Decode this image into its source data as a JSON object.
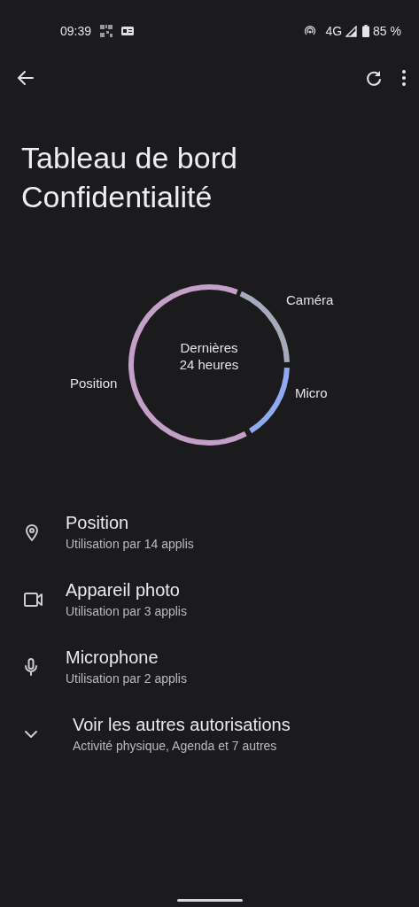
{
  "status_bar": {
    "time": "09:39",
    "network": "4G",
    "battery": "85 %"
  },
  "title": "Tableau de bord Confidentialité",
  "usage_ring": {
    "center_text": [
      "Dernières",
      "24 heures"
    ],
    "segments": [
      {
        "label": "Position",
        "color": "#c49fc8"
      },
      {
        "label": "Caméra",
        "color": "#a6abbb"
      },
      {
        "label": "Micro",
        "color": "#8fa9f2"
      }
    ]
  },
  "permissions": [
    {
      "kind": "location",
      "title": "Position",
      "subtitle": "Utilisation par 14 applis"
    },
    {
      "kind": "camera",
      "title": "Appareil photo",
      "subtitle": "Utilisation par 3 applis"
    },
    {
      "kind": "mic",
      "title": "Microphone",
      "subtitle": "Utilisation par 2 applis"
    },
    {
      "kind": "expand",
      "title": "Voir les autres autorisations",
      "subtitle": "Activité physique, Agenda et 7 autres"
    }
  ]
}
